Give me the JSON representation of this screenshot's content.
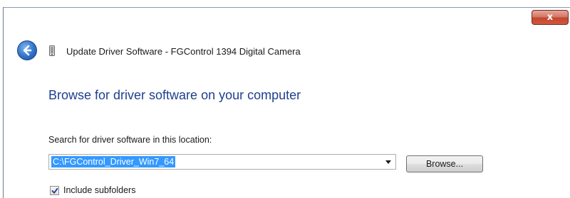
{
  "window": {
    "close_glyph": "x",
    "title": "Update Driver Software - FGControl 1394 Digital Camera"
  },
  "icons": {
    "close": "close-icon",
    "back": "back-arrow-icon",
    "device": "device-icon",
    "dropdown": "chevron-down-icon",
    "checkbox": "checkmark-icon"
  },
  "colors": {
    "heading": "#1e3f8f",
    "selection": "#3399ff",
    "close_button": "#c4452f",
    "back_button": "#2f72c8"
  },
  "main": {
    "heading": "Browse for driver software on your computer",
    "search_label": "Search for driver software in this location:",
    "path_value": "C:\\FGControl_Driver_Win7_64",
    "browse_label": "Browse...",
    "include_subfolders_label": "Include subfolders",
    "include_subfolders_checked": true
  }
}
